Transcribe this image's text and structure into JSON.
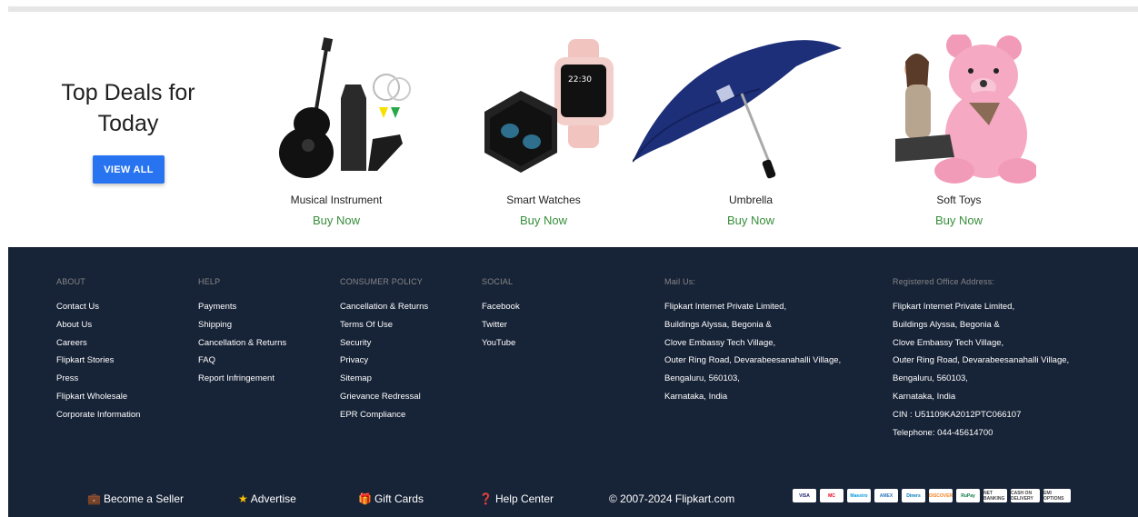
{
  "deals": {
    "title": "Top Deals for Today",
    "view_all": "VIEW ALL",
    "products": [
      {
        "name": "Musical Instrument",
        "cta": "Buy Now"
      },
      {
        "name": "Smart Watches",
        "cta": "Buy Now"
      },
      {
        "name": "Umbrella",
        "cta": "Buy Now"
      },
      {
        "name": "Soft Toys",
        "cta": "Buy Now"
      }
    ]
  },
  "footer": {
    "about": {
      "heading": "ABOUT",
      "links": [
        "Contact Us",
        "About Us",
        "Careers",
        "Flipkart Stories",
        "Press",
        "Flipkart Wholesale",
        "Corporate Information"
      ]
    },
    "help": {
      "heading": "HELP",
      "links": [
        "Payments",
        "Shipping",
        "Cancellation & Returns",
        "FAQ",
        "Report Infringement"
      ]
    },
    "policy": {
      "heading": "CONSUMER POLICY",
      "links": [
        "Cancellation & Returns",
        "Terms Of Use",
        "Security",
        "Privacy",
        "Sitemap",
        "Grievance Redressal",
        "EPR Compliance"
      ]
    },
    "social": {
      "heading": "SOCIAL",
      "links": [
        "Facebook",
        "Twitter",
        "YouTube"
      ]
    },
    "mail": {
      "heading": "Mail Us:",
      "lines": [
        "Flipkart Internet Private Limited,",
        "Buildings Alyssa, Begonia &",
        "Clove Embassy Tech Village,",
        "Outer Ring Road, Devarabeesanahalli Village,",
        "Bengaluru, 560103,",
        "Karnataka, India"
      ]
    },
    "office": {
      "heading": "Registered Office Address:",
      "lines": [
        "Flipkart Internet Private Limited,",
        "Buildings Alyssa, Begonia &",
        "Clove Embassy Tech Village,",
        "Outer Ring Road, Devarabeesanahalli Village,",
        "Bengaluru, 560103,",
        "Karnataka, India",
        "CIN : U51109KA2012PTC066107",
        "Telephone: 044-45614700"
      ]
    },
    "bottom": {
      "seller": "Become a Seller",
      "advertise": "Advertise",
      "gift": "Gift Cards",
      "help": "Help Center",
      "copyright": "© 2007-2024 Flipkart.com"
    },
    "payments": [
      "VISA",
      "MC",
      "Maestro",
      "AMEX",
      "Diners",
      "DISCOVER",
      "RuPay",
      "NET BANKING",
      "CASH ON DELIVERY",
      "EMI OPTIONS"
    ]
  }
}
